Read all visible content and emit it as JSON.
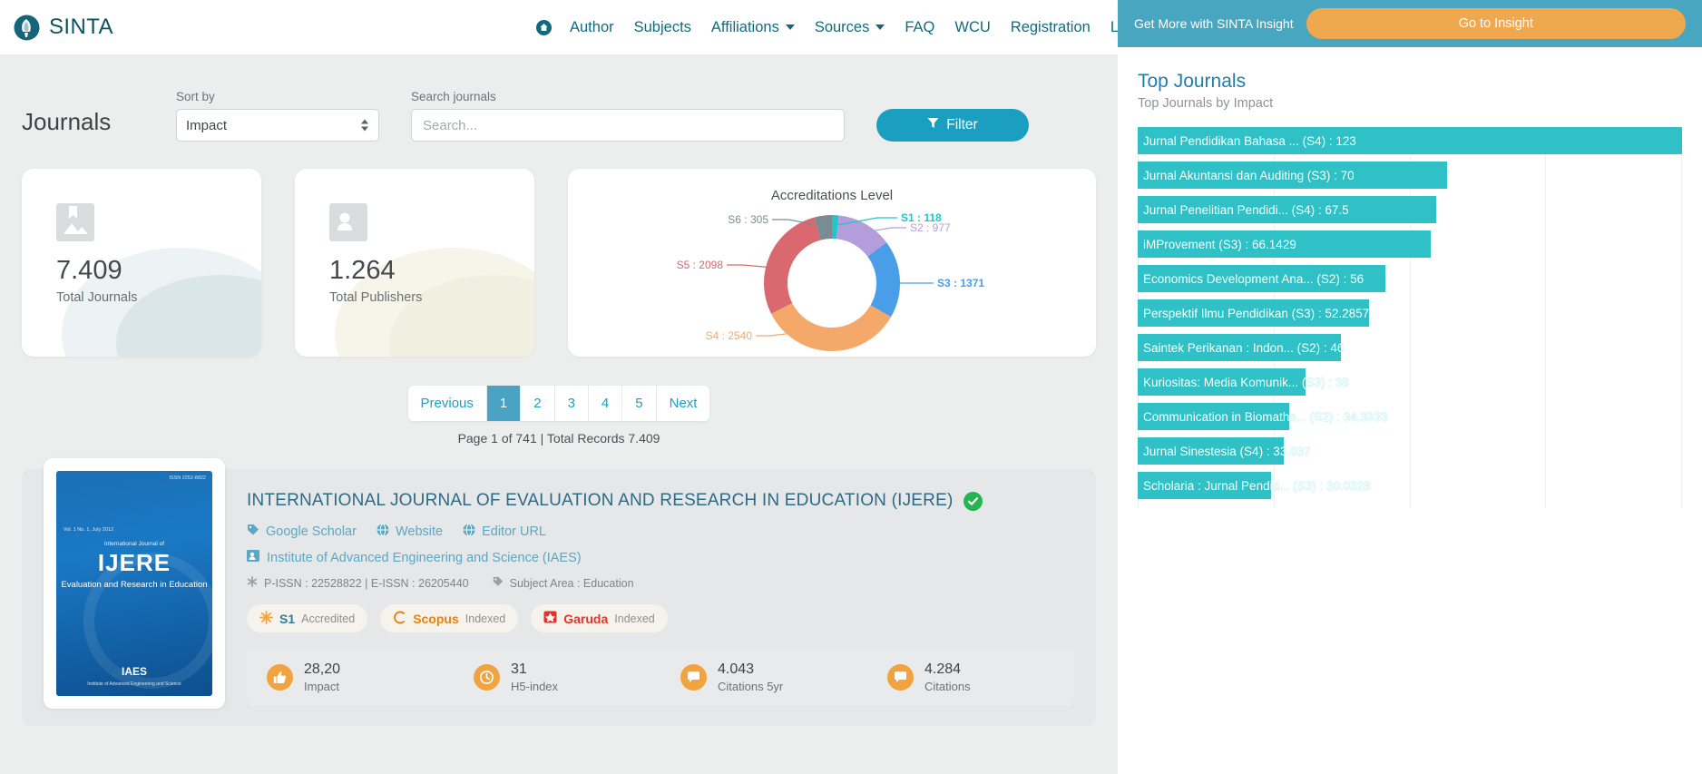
{
  "navbar": {
    "brand": "SINTA",
    "brand_icon": "sinta-logo-icon",
    "home_icon": "home-icon",
    "links": [
      {
        "label": "Author",
        "dropdown": false
      },
      {
        "label": "Subjects",
        "dropdown": false
      },
      {
        "label": "Affiliations",
        "dropdown": true
      },
      {
        "label": "Sources",
        "dropdown": true
      },
      {
        "label": "FAQ",
        "dropdown": false
      },
      {
        "label": "WCU",
        "dropdown": false
      },
      {
        "label": "Registration",
        "dropdown": false
      },
      {
        "label": "Login",
        "dropdown": false
      }
    ]
  },
  "toolbar": {
    "page_title": "Journals",
    "sort_label": "Sort by",
    "sort_value": "Impact",
    "search_label": "Search journals",
    "search_value": "",
    "search_placeholder": "Search...",
    "filter_label": "Filter",
    "filter_icon": "funnel-icon"
  },
  "stats": [
    {
      "value": "7.409",
      "label": "Total Journals",
      "icon": "journal-image-icon"
    },
    {
      "value": "1.264",
      "label": "Total Publishers",
      "icon": "publisher-contact-icon"
    }
  ],
  "chart_data": {
    "type": "pie",
    "title": "Accreditations Level",
    "labels": [
      "S1",
      "S2",
      "S3",
      "S4",
      "S5",
      "S6"
    ],
    "values": [
      118,
      977,
      1371,
      2540,
      2098,
      305
    ],
    "colors": [
      "#21c6c9",
      "#b39ddb",
      "#4a9ee8",
      "#f4a96a",
      "#d9686f",
      "#7a8b93"
    ],
    "label_texts": [
      "S1 : 118",
      "S2 : 977",
      "S3 : 1371",
      "S4 : 2540",
      "S5 : 2098",
      "S6 : 305"
    ],
    "legend": "callout",
    "donut": true
  },
  "pagination": {
    "previous": "Previous",
    "next": "Next",
    "pages": [
      "1",
      "2",
      "3",
      "4",
      "5"
    ],
    "active": "1",
    "info": "Page 1 of 741 | Total Records 7.409"
  },
  "journal": {
    "title": "INTERNATIONAL JOURNAL OF EVALUATION AND RESEARCH IN EDUCATION (IJERE)",
    "verified_icon": "verified-check-icon",
    "cover": {
      "issn": "ISSN 2252-8822",
      "volume": "Vol. 1 No. 1, July 2012",
      "line1": "International Journal of",
      "acronym": "IJERE",
      "line2": "Evaluation and Research in Education",
      "publisher_mark": "IAES",
      "footer": "Institute of Advanced Engineering and Science"
    },
    "links": [
      {
        "label": "Google Scholar",
        "icon": "tag-icon"
      },
      {
        "label": "Website",
        "icon": "globe-icon"
      },
      {
        "label": "Editor URL",
        "icon": "globe-icon"
      }
    ],
    "publisher": "Institute of Advanced Engineering and Science (IAES)",
    "publisher_icon": "id-card-icon",
    "meta": [
      {
        "text": "P-ISSN : 22528822 | E-ISSN : 26205440",
        "icon": "asterisk-icon"
      },
      {
        "text": "Subject Area : Education",
        "icon": "tag-icon"
      }
    ],
    "badges": [
      {
        "name": "S1",
        "suffix": "Accredited",
        "icon": "star-burst-icon",
        "color": "#f0a33e"
      },
      {
        "name": "Scopus",
        "suffix": "Indexed",
        "icon": "scopus-icon",
        "color": "#e8820c"
      },
      {
        "name": "Garuda",
        "suffix": "Indexed",
        "icon": "garuda-icon",
        "color": "#e0352f"
      }
    ],
    "metrics": [
      {
        "value": "28,20",
        "label": "Impact",
        "icon": "thumbs-up-icon"
      },
      {
        "value": "31",
        "label": "H5-index",
        "icon": "clock-icon"
      },
      {
        "value": "4.043",
        "label": "Citations 5yr",
        "icon": "comment-icon"
      },
      {
        "value": "4.284",
        "label": "Citations",
        "icon": "comment-icon"
      }
    ]
  },
  "insight": {
    "text": "Get More with SINTA Insight",
    "button": "Go to Insight"
  },
  "top_journals": {
    "title": "Top Journals",
    "subtitle": "Top Journals by Impact",
    "bars": [
      {
        "label": "Jurnal Pendidikan Bahasa ... (S4) : 123",
        "value": 123
      },
      {
        "label": "Jurnal Akuntansi dan Auditing (S3) : 70",
        "value": 70
      },
      {
        "label": "Jurnal Penelitian Pendidi... (S4) : 67.5",
        "value": 67.5
      },
      {
        "label": "iMProvement (S3) : 66.1429",
        "value": 66.1429
      },
      {
        "label": "Economics Development Ana... (S2) : 56",
        "value": 56
      },
      {
        "label": "Perspektif Ilmu Pendidikan (S3) : 52.2857",
        "value": 52.2857
      },
      {
        "label": "Saintek Perikanan : Indon... (S2) : 46",
        "value": 46
      },
      {
        "label": "Kuriositas: Media Komunik... (S3) : 38",
        "value": 38
      },
      {
        "label": "Communication in Biomathe... (S2) : 34.3333",
        "value": 34.3333
      },
      {
        "label": "Jurnal Sinestesia (S4) : 33.037",
        "value": 33.037
      },
      {
        "label": "Scholaria : Jurnal Pendid... (S3) : 30.0328",
        "value": 30.0328
      }
    ],
    "bar_color": "#2fc1c6",
    "max_value": 123
  },
  "colors": {
    "brand_teal": "#0c5460",
    "accent_cyan": "#1b9fc0",
    "bar_cyan": "#2fc1c6",
    "insight_blue": "#49a6c0",
    "insight_orange": "#efa84e"
  }
}
